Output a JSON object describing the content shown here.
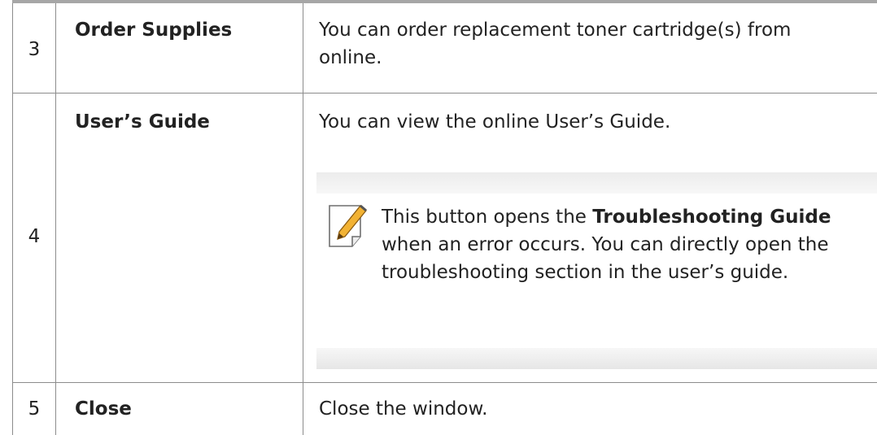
{
  "rows": [
    {
      "number": "3",
      "feature": "Order Supplies",
      "description_line1": "You can order replacement toner cartridge(s) from",
      "description_line2": "online."
    },
    {
      "number": "4",
      "feature": "User’s Guide",
      "description": "You can view the online User’s Guide.",
      "note": {
        "icon": "note-pencil-icon",
        "text_before": "This button opens the ",
        "bold": "Troubleshooting Guide",
        "text_after": " when an error occurs. You can directly open the troubleshooting section in the user’s guide."
      }
    },
    {
      "number": "5",
      "feature": "Close",
      "description": "Close the window."
    }
  ],
  "colors": {
    "rule": "#a6a6a6",
    "grid": "#8c8c8c",
    "note_band": "#ececec",
    "icon_pencil": "#f2b233"
  }
}
